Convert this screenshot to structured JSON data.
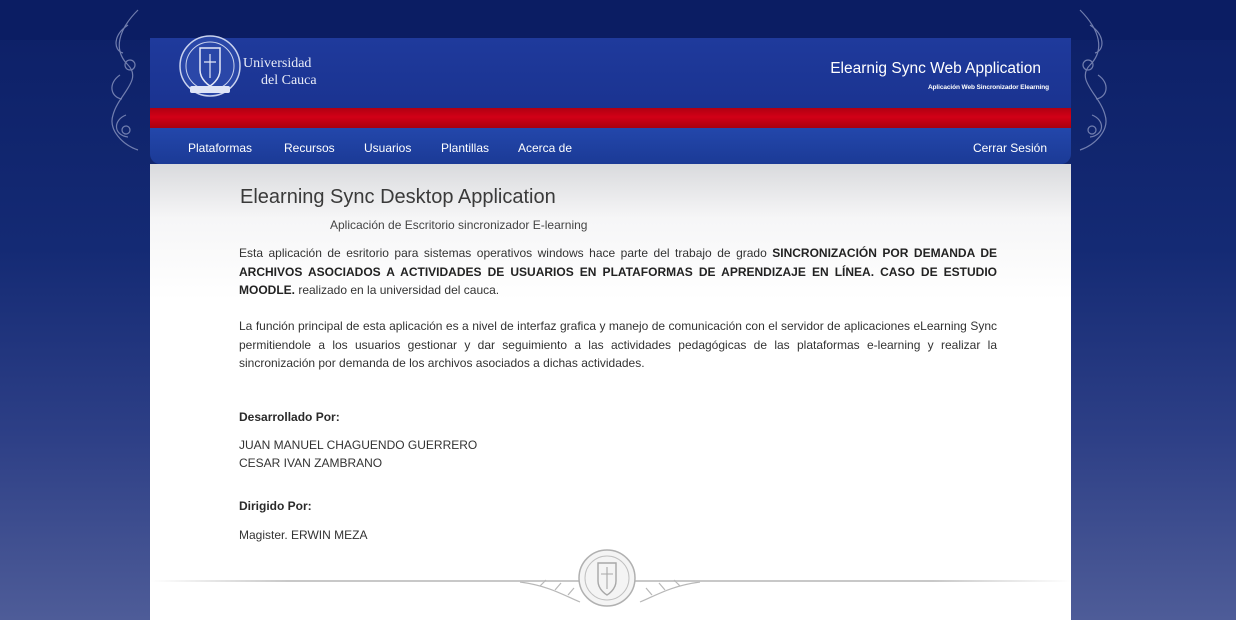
{
  "brand": {
    "university_line1": "Universidad",
    "university_line2": "del Cauca"
  },
  "header": {
    "app_title": "Elearnig Sync Web Application",
    "app_subtitle": "Aplicación Web Sincronizador Elearning"
  },
  "nav": {
    "items": [
      "Plataformas",
      "Recursos",
      "Usuarios",
      "Plantillas",
      "Acerca de"
    ],
    "logout": "Cerrar Sesión"
  },
  "main": {
    "title": "Elearning Sync Desktop Application",
    "subtitle": "Aplicación de Escritorio sincronizador E-learning",
    "p1_intro": "Esta aplicación de esritorio para sistemas operativos windows hace parte del trabajo de grado ",
    "p1_bold": "SINCRONIZACIÓN POR DEMANDA DE ARCHIVOS ASOCIADOS A ACTIVIDADES DE USUARIOS EN PLATAFORMAS DE APRENDIZAJE EN LÍNEA. CASO DE ESTUDIO MOODLE.",
    "p1_end": " realizado en la universidad del cauca.",
    "p2": "La función principal de esta aplicación es a nivel de interfaz grafica y manejo de comunicación con el servidor de aplicaciones eLearning Sync permitiendole a los usuarios gestionar y dar seguimiento a las actividades pedagógicas de las plataformas e-learning y realizar la sincronización por demanda de los archivos asociados a dichas actividades.",
    "developed_label": "Desarrollado Por:",
    "developers": [
      "JUAN MANUEL CHAGUENDO GUERRERO",
      "CESAR IVAN ZAMBRANO"
    ],
    "directed_label": "Dirigido Por:",
    "director": "Magister. ERWIN MEZA"
  },
  "colors": {
    "navy": "#1a3390",
    "red": "#d20016",
    "background": "#0c1f66"
  },
  "icons": {
    "seal": "university-seal-icon",
    "ornament": "baroque-ornament-icon"
  }
}
